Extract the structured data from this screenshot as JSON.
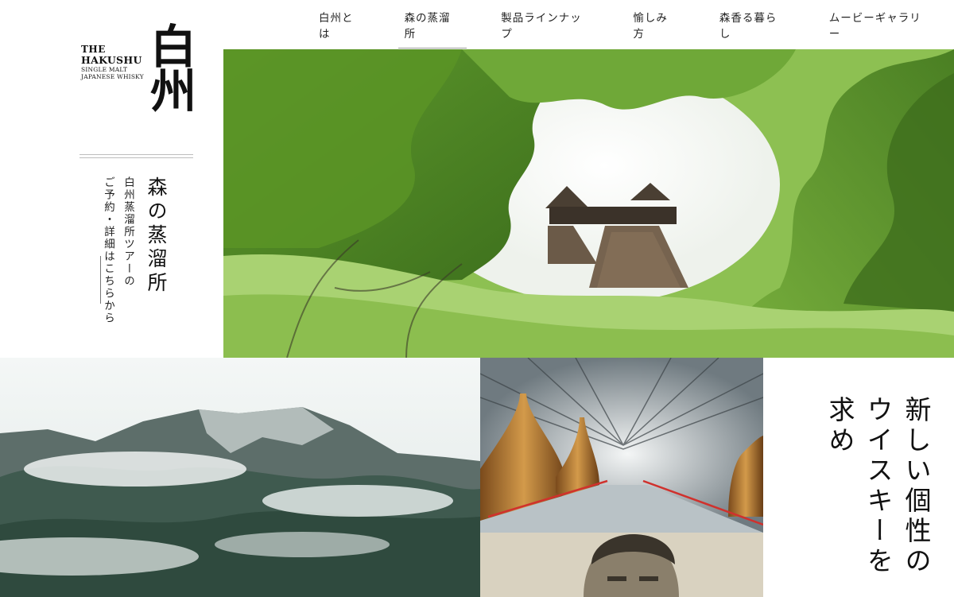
{
  "nav": {
    "items": [
      "白州とは",
      "森の蒸溜所",
      "製品ラインナップ",
      "愉しみ方",
      "森香る暮らし",
      "ムービーギャラリー"
    ],
    "active_index": 1
  },
  "logo": {
    "the": "THE",
    "brand": "HAKUSHU",
    "line3": "SINGLE MALT",
    "line4": "JAPANESE WHISKY",
    "kanji": "白州"
  },
  "sidebar": {
    "title": "森の蒸溜所",
    "tour_line1": "白州蒸溜所ツアーの",
    "tour_line2": "ご予約・詳細はこちらから"
  },
  "images": {
    "hero": "forest-distillery-photo",
    "mountain": "mountain-photo",
    "stills": "pot-stills-photo",
    "portrait": "founder-portrait-photo"
  },
  "headline": {
    "line1": "新しい個性の",
    "line2": "ウイスキーを求め"
  }
}
